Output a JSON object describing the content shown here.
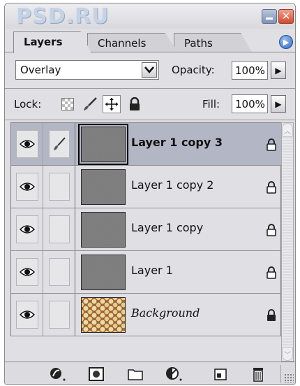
{
  "window": {
    "logo_text": "PSD.RU",
    "minimize_icon": "minimize-icon",
    "close_glyph": "✕"
  },
  "tabs": [
    {
      "label": "Layers",
      "active": true
    },
    {
      "label": "Channels",
      "active": false
    },
    {
      "label": "Paths",
      "active": false
    }
  ],
  "panel_menu_icon": "panel-menu-arrow-icon",
  "blend": {
    "mode_value": "Overlay",
    "opacity_label": "Opacity:",
    "opacity_value": "100%"
  },
  "lock": {
    "label": "Lock:",
    "icons": [
      "lock-transparent-pixels-icon",
      "lock-image-pixels-icon",
      "lock-position-icon",
      "lock-all-icon"
    ],
    "fill_label": "Fill:",
    "fill_value": "100%"
  },
  "layers": [
    {
      "name": "Layer 1 copy 3",
      "selected": true,
      "visible": true,
      "brush_shown": true,
      "thumbnail": "gray-texture"
    },
    {
      "name": "Layer 1 copy 2",
      "selected": false,
      "visible": true,
      "brush_shown": false,
      "thumbnail": "gray-texture"
    },
    {
      "name": "Layer 1 copy",
      "selected": false,
      "visible": true,
      "brush_shown": false,
      "thumbnail": "gray-texture"
    },
    {
      "name": "Layer 1",
      "selected": false,
      "visible": true,
      "brush_shown": false,
      "thumbnail": "gray-texture"
    },
    {
      "name": "Background",
      "selected": false,
      "visible": true,
      "brush_shown": false,
      "thumbnail": "honeycomb-photo"
    }
  ],
  "toolbar": {
    "icons": [
      "layer-style-icon",
      "layer-mask-icon",
      "new-group-folder-icon",
      "adjustment-layer-icon",
      "new-layer-icon",
      "trash-icon"
    ]
  },
  "colors": {
    "panel_bg": "#e0dfe3",
    "selected_row": "#b3b6c4",
    "close_button": "#d24a2e",
    "menu_button": "#2d66c4"
  }
}
